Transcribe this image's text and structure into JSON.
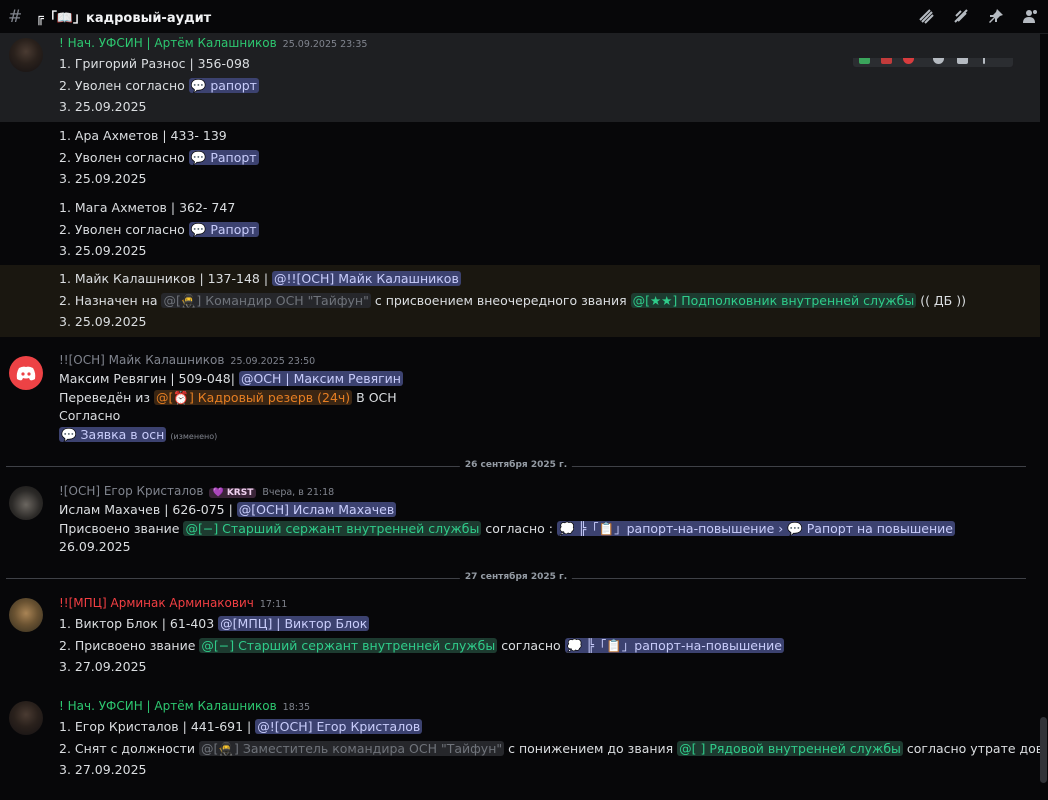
{
  "header": {
    "hash": "#",
    "channel": "╔「📖」кадровый-аудит"
  },
  "dividers": [
    "26 сентября 2025 г.",
    "27 сентября 2025 г."
  ],
  "messages": {
    "m1": {
      "author": "! Нач. УФСИН | Артём Калашников",
      "time": "25.09.2025 23:35",
      "lines": [
        "1. Григорий Разнос | 356-098",
        "2. Уволен согласно",
        "3. 25.09.2025"
      ],
      "ref": "рапорт"
    },
    "m2": {
      "lines": [
        "1. Ара Ахметов | 433- 139",
        "2. Уволен согласно",
        "3. 25.09.2025"
      ],
      "ref": "Рапорт"
    },
    "m3": {
      "lines": [
        "1. Мага Ахметов | 362- 747",
        "2. Уволен согласно",
        "3. 25.09.2025"
      ],
      "ref": "Рапорт"
    },
    "m4": {
      "line1": "1. Майк Калашников | 137-148 |",
      "mention1": "@!![ОСН] Майк Калашников",
      "line2a": "2. Назначен на",
      "role1": "@[🥷] Командир ОСН \"Тайфун\"",
      "line2b": "с присвоением внеочередного звания",
      "role2": "@[★★] Подполковник внутренней службы",
      "line2c": "(( ДБ ))",
      "line3": "3. 25.09.2025"
    },
    "m5": {
      "author": "!![ОСН] Майк Калашников",
      "time": "25.09.2025 23:50",
      "line1": "Максим Ревягин | 509-048|",
      "mention1": "@ОСН | Максим Ревягин",
      "line2a": "Переведён из",
      "role1": "@[⏰] Кадровый резерв (24ч)",
      "line2b": "В ОСН",
      "line3": "Согласно",
      "thread": "Заявка в осн",
      "edited": "(изменено)"
    },
    "m6": {
      "author": "![ОСН] Егор Кристалов",
      "badge": "KRST",
      "time": "Вчера, в 21:18",
      "line1": "Ислам Махачев | 626-075 |",
      "mention1": "@[ОСН] Ислам Махачев",
      "line2a": "Присвоено звание",
      "role1": "@[−] Старший сержант внутренней службы",
      "line2b": "согласно :",
      "channel": "╠「📋」рапорт-на-повышение",
      "thread": "Рапорт на повышение",
      "line3": "26.09.2025"
    },
    "m7": {
      "author": "!![МПЦ] Арминак Арминакович",
      "time": "17:11",
      "line1": "1. Виктор Блок | 61-403",
      "mention1": "@[МПЦ] | Виктор Блок",
      "line2a": "2. Присвоено звание",
      "role1": "@[−] Старший сержант внутренней службы",
      "line2b": "согласно",
      "channel": "╠「📋」рапорт-на-повышение",
      "line3": "3. 27.09.2025"
    },
    "m8": {
      "author": "! Нач. УФСИН | Артём Калашников",
      "time": "18:35",
      "line1": "1. Егор Кристалов | 441-691 |",
      "mention1": "@![ОСН] Егор Кристалов",
      "line2a": "2. Снят с должности",
      "role1": "@[🥷] Заместитель командира ОСН \"Тайфун\"",
      "line2b": "с понижением до звания",
      "role2": "@[ ] Рядовой внутренней службы",
      "line2c": "согласно утрате доверия",
      "line3": "3. 27.09.2025"
    }
  },
  "colors": {
    "bg": "#070709",
    "hover": "#1e1f22",
    "green_name": "#2dc770",
    "red_name": "#f23f43",
    "mention": "#c9cdfb",
    "role_green": "#2fcc8a"
  }
}
